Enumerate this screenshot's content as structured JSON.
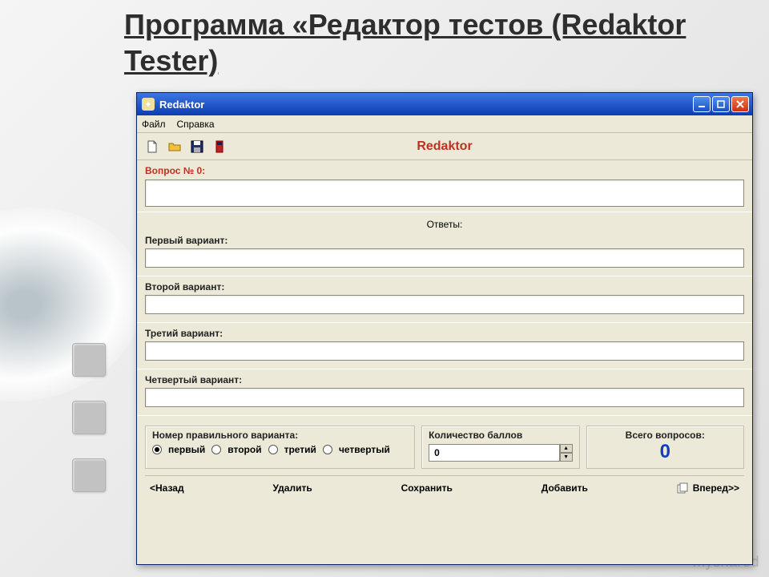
{
  "slide": {
    "title": "Программа «Редактор тестов (Redaktor Tester)",
    "watermark": "myshared"
  },
  "window": {
    "title": "Redaktor",
    "menu": {
      "file": "Файл",
      "help": "Справка"
    },
    "toolbar_title": "Redaktor",
    "question_label": "Вопрос № 0:",
    "question_value": "",
    "answers_header": "Ответы:",
    "variant1_label": "Первый вариант:",
    "variant1_value": "",
    "variant2_label": "Второй вариант:",
    "variant2_value": "",
    "variant3_label": "Третий вариант:",
    "variant3_value": "",
    "variant4_label": "Четвертый вариант:",
    "variant4_value": "",
    "correct_label": "Номер правильного варианта:",
    "radio1": "первый",
    "radio2": "второй",
    "radio3": "третий",
    "radio4": "четвертый",
    "points_label": "Количество баллов",
    "points_value": "0",
    "total_label": "Всего вопросов:",
    "total_value": "0",
    "nav": {
      "back": "<Назад",
      "delete": "Удалить",
      "save": "Сохранить",
      "add": "Добавить",
      "forward": "Вперед>>"
    }
  }
}
